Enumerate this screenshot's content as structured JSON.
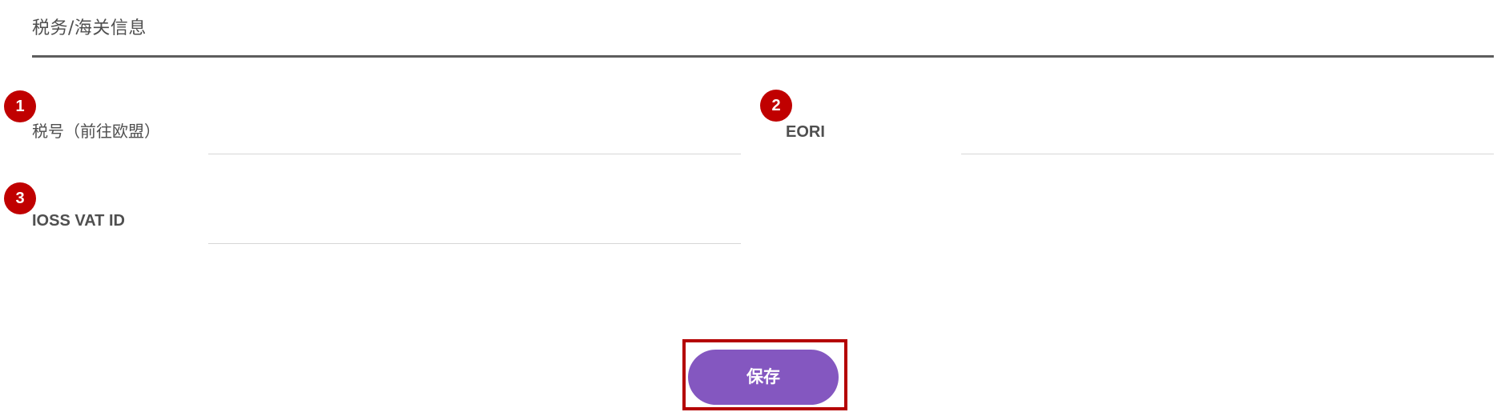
{
  "section": {
    "title": "税务/海关信息"
  },
  "fields": [
    {
      "badge": "1",
      "label": "税号（前往欧盟）",
      "value": ""
    },
    {
      "badge": "2",
      "label": "EORI",
      "value": ""
    },
    {
      "badge": "3",
      "label": "IOSS VAT ID",
      "value": ""
    }
  ],
  "actions": {
    "save_label": "保存"
  },
  "colors": {
    "accent": "#8457c0",
    "badge": "#c00000",
    "highlight_border": "#b40000",
    "divider": "#5d5d5d"
  }
}
